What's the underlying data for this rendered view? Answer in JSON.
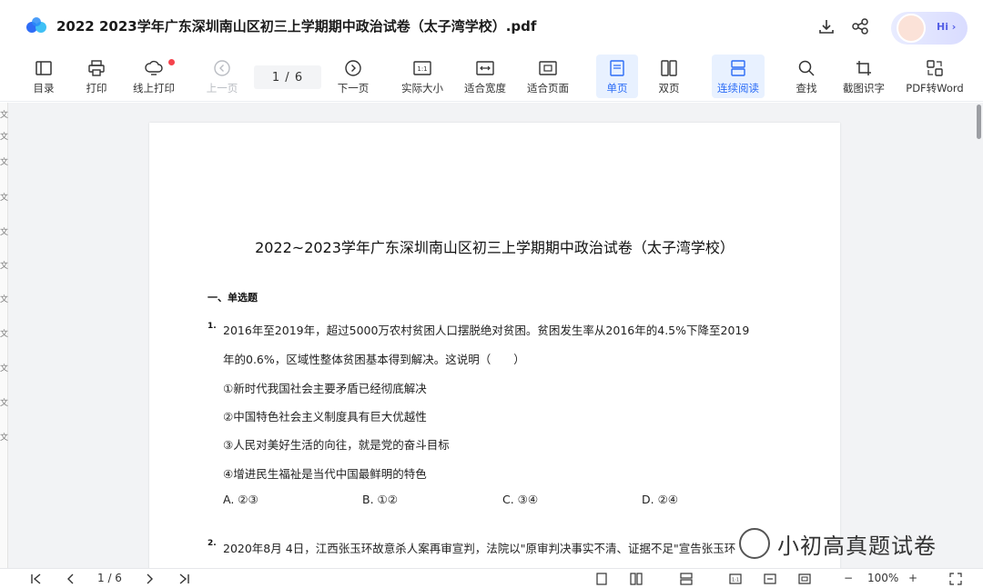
{
  "window": {
    "title": "2022 2023学年广东深圳南山区初三上学期期中政治试卷（太子湾学校）.pdf",
    "avatar_label": "Hi ›"
  },
  "icons": {
    "logo": "baidu-netdisk-logo",
    "download": "download-icon",
    "share": "share-icon"
  },
  "toolbar": {
    "toc": "目录",
    "print": "打印",
    "online_print": "线上打印",
    "prev_page": "上一页",
    "page_indicator": "1 / 6",
    "next_page": "下一页",
    "actual_size": "实际大小",
    "fit_width": "适合宽度",
    "fit_page": "适合页面",
    "single_page": "单页",
    "double_page": "双页",
    "continuous": "连续阅读",
    "find": "查找",
    "ocr": "截图识字",
    "pdf_to_word": "PDF转Word",
    "accent_color": "#2b6cf6"
  },
  "document": {
    "title": "2022~2023学年广东深圳南山区初三上学期期中政治试卷（太子湾学校）",
    "section": "一、单选题",
    "q1": {
      "number": "1.",
      "line1": "2016年至2019年，超过5000万农村贫困人口摆脱绝对贫困。贫困发生率从2016年的4.5%下降至2019",
      "line2": "年的0.6%，区域性整体贫困基本得到解决。这说明（　　）",
      "items": [
        "①新时代我国社会主要矛盾已经彻底解决",
        "②中国特色社会主义制度具有巨大优越性",
        "③人民对美好生活的向往，就是党的奋斗目标",
        "④增进民生福祉是当代中国最鲜明的特色"
      ],
      "options": [
        "A. ②③",
        "B. ①②",
        "C. ③④",
        "D. ②④"
      ]
    },
    "q2": {
      "number": "2.",
      "line1": "2020年8月 4日，江西张玉环故意杀人案再审宣判，法院以\"原审判决事实不清、证据不足\"宣告张玉环"
    }
  },
  "watermark": "小初高真题试卷",
  "left_strip": [
    "文",
    "文",
    "文",
    "文",
    "文",
    "文",
    "文",
    "文",
    "文",
    "文",
    "文"
  ],
  "statusbar": {
    "page_indicator": "1 / 6",
    "zoom": "100%",
    "minus": "−",
    "plus": "+"
  }
}
